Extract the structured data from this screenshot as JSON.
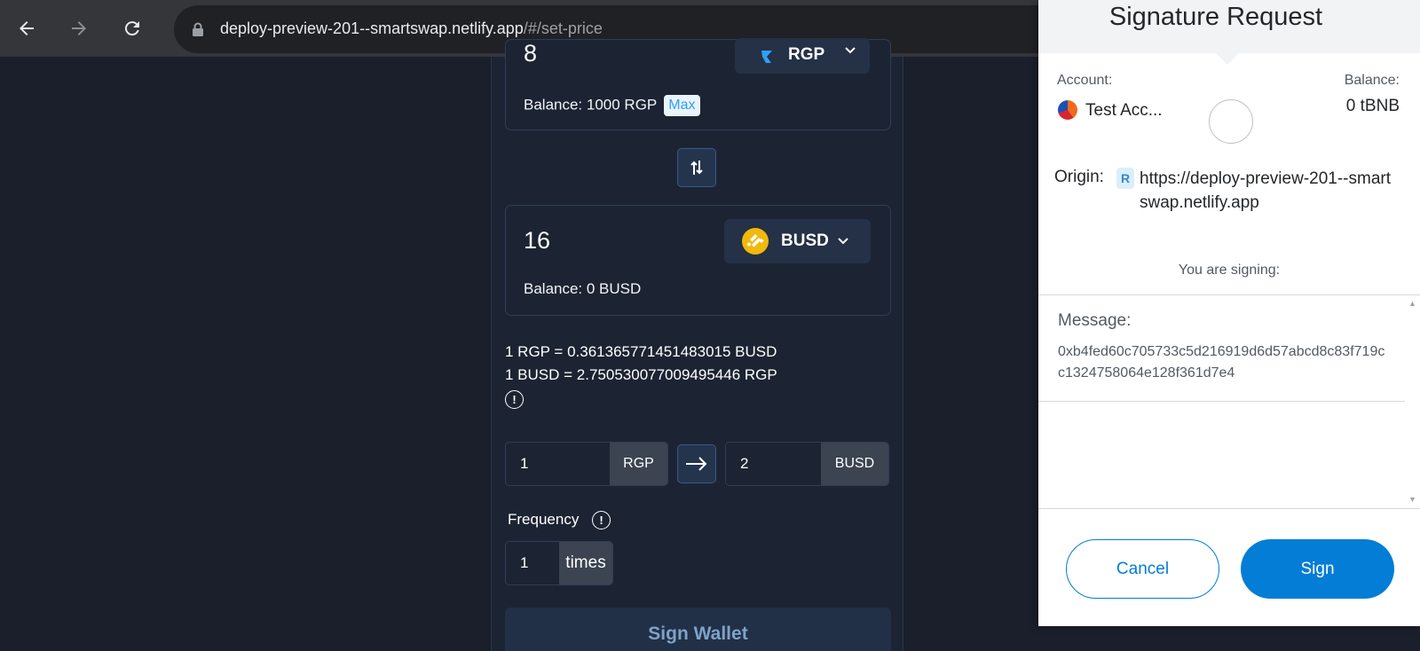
{
  "browser": {
    "url_host": "deploy-preview-201--smartswap.netlify.app",
    "url_path": "/#/set-price"
  },
  "swap": {
    "from": {
      "amount": "8",
      "token": "RGP",
      "balance_text": "Balance: 1000 RGP",
      "max_label": "Max"
    },
    "to": {
      "amount": "16",
      "token": "BUSD",
      "balance_text": "Balance: 0 BUSD"
    },
    "rate_1": "1 RGP = 0.361365771451483015 BUSD",
    "rate_2": "1 BUSD = 2.75053007700949544​6 RGP",
    "price_from_value": "1",
    "price_from_unit": "RGP",
    "price_to_value": "2",
    "price_to_unit": "BUSD",
    "frequency_label": "Frequency",
    "frequency_value": "1",
    "frequency_unit": "times",
    "sign_wallet_label": "Sign Wallet"
  },
  "metamask": {
    "title": "Signature Request",
    "account_label": "Account:",
    "account_name": "Test Acc...",
    "balance_label": "Balance:",
    "balance_value": "0 tBNB",
    "origin_label": "Origin:",
    "origin_url": "https://deploy-preview-201--smartswap.netlify.app",
    "signing_label": "You are signing:",
    "message_label": "Message:",
    "message_value": "0xb4fed60c705733c5d216919d6d57abcd8c83f719cc1324758064e128f361d7e4",
    "cancel_label": "Cancel",
    "sign_label": "Sign"
  },
  "colors": {
    "app_bg": "#1a1f2b",
    "accent_blue": "#037dd6",
    "busd_yellow": "#f0b90b"
  }
}
